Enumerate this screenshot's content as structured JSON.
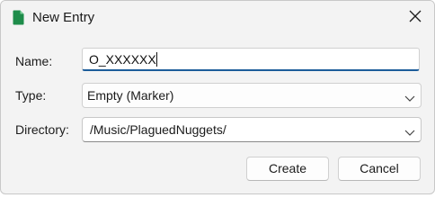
{
  "window": {
    "title": "New Entry",
    "icon": "green-document-icon",
    "close_icon": "close-icon"
  },
  "form": {
    "name": {
      "label": "Name:",
      "value": "O_XXXXXX"
    },
    "type": {
      "label": "Type:",
      "selected": "Empty (Marker)"
    },
    "directory": {
      "label": "Directory:",
      "value": "/Music/PlaguedNuggets/"
    }
  },
  "buttons": {
    "create": "Create",
    "cancel": "Cancel"
  },
  "colors": {
    "accent": "#1c5c9a",
    "icon_green": "#1e8c4a",
    "background": "#f3f3f3"
  }
}
